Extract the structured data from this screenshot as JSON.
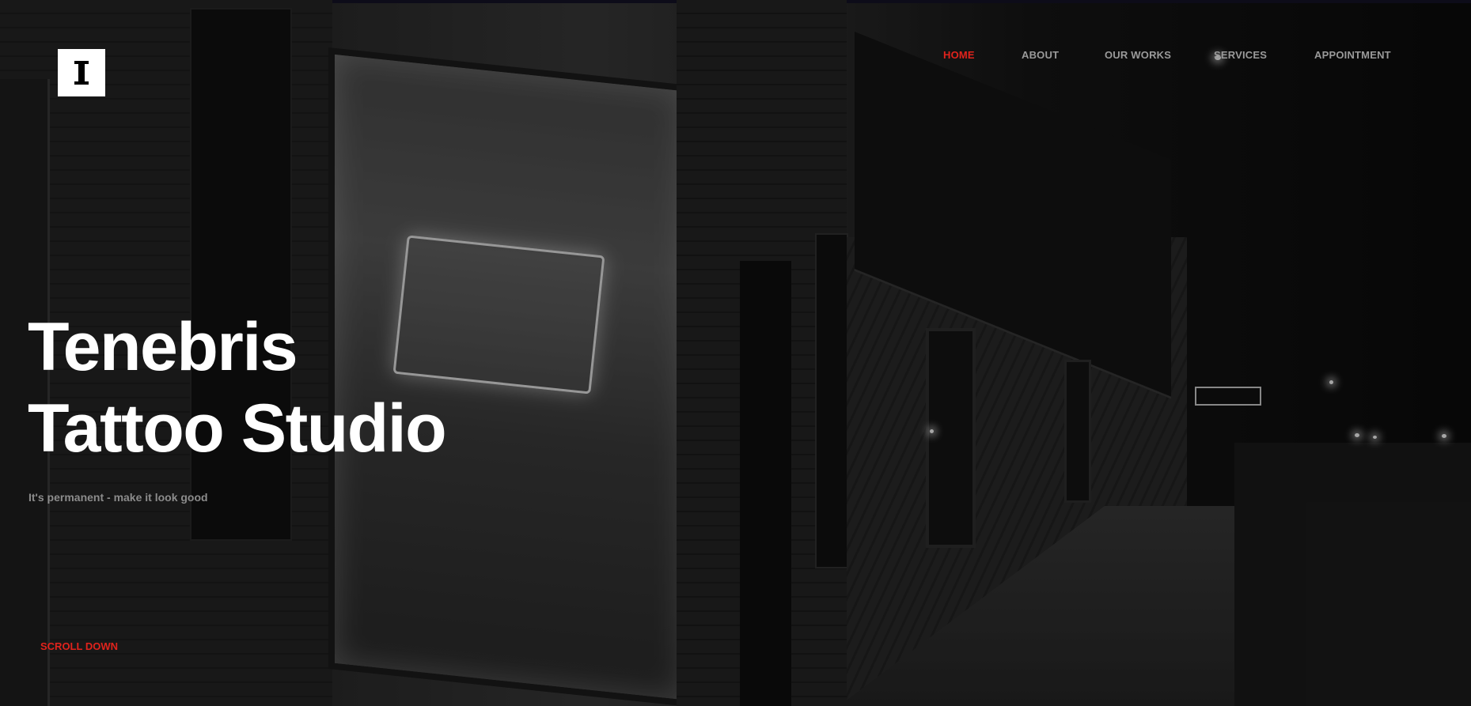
{
  "brand": {
    "logo_icon": "studio-logo-icon"
  },
  "nav": {
    "items": [
      {
        "label": "HOME",
        "active": true
      },
      {
        "label": "ABOUT",
        "active": false
      },
      {
        "label": "OUR WORKS",
        "active": false
      },
      {
        "label": "SERVICES",
        "active": false
      },
      {
        "label": "APPOINTMENT",
        "active": false
      }
    ]
  },
  "hero": {
    "title_line1": "Tenebris",
    "title_line2": "Tattoo Studio",
    "subtitle": "It's permanent - make it look good",
    "scroll_label": "SCROLL DOWN",
    "background_image": "night-street-tattoo-shop-photo"
  },
  "colors": {
    "accent": "#e0231c",
    "text_primary": "#ffffff",
    "text_muted": "#9a9a9a",
    "logo_bg": "#ffffff"
  }
}
